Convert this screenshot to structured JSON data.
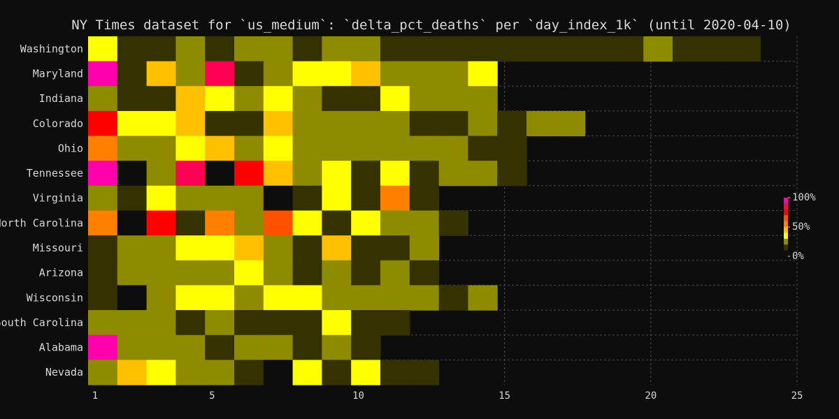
{
  "chart_data": {
    "type": "heatmap",
    "title": "NY Times dataset for `us_medium`: `delta_pct_deaths` per `day_index_1k` (until 2020-04-10)",
    "xlabel": "",
    "ylabel": "",
    "x_ticks": [
      "1",
      "5",
      "10",
      "15",
      "20",
      "25"
    ],
    "xlim": [
      1,
      25
    ],
    "grid": true,
    "legend": {
      "position": "right",
      "labels": [
        "100%",
        "50%",
        "0%"
      ]
    },
    "colors": {
      "background": "#0d0d0d",
      "l0": "#0d0d0d",
      "l1": "#343200",
      "l2": "#8f8b00",
      "l3": "#ffff00",
      "l4": "#ffc000",
      "l5": "#ff8000",
      "l6": "#ff5200",
      "l7": "#ff0000",
      "l8": "#ff0055",
      "l9": "#ff00aa"
    },
    "rows": [
      {
        "label": "Washington",
        "levels": [
          3,
          1,
          1,
          2,
          1,
          2,
          2,
          1,
          2,
          2,
          1,
          1,
          1,
          1,
          1,
          1,
          1,
          1,
          1,
          2,
          1,
          1,
          1
        ]
      },
      {
        "label": "Maryland",
        "levels": [
          9,
          1,
          4,
          2,
          8,
          1,
          2,
          3,
          3,
          4,
          2,
          2,
          2,
          3
        ]
      },
      {
        "label": "Indiana",
        "levels": [
          2,
          1,
          1,
          4,
          3,
          2,
          3,
          2,
          1,
          1,
          3,
          2,
          2,
          2
        ]
      },
      {
        "label": "Colorado",
        "levels": [
          7,
          3,
          3,
          4,
          1,
          1,
          4,
          2,
          2,
          2,
          2,
          1,
          1,
          2,
          1,
          2,
          2
        ]
      },
      {
        "label": "Ohio",
        "levels": [
          5,
          2,
          2,
          3,
          4,
          2,
          3,
          2,
          2,
          2,
          2,
          2,
          2,
          1,
          1
        ]
      },
      {
        "label": "Tennessee",
        "levels": [
          9,
          0,
          2,
          8,
          0,
          7,
          4,
          2,
          3,
          1,
          3,
          1,
          2,
          2,
          1
        ]
      },
      {
        "label": "Virginia",
        "levels": [
          2,
          1,
          3,
          2,
          2,
          2,
          0,
          1,
          3,
          1,
          5,
          1
        ]
      },
      {
        "label": "North Carolina",
        "levels": [
          5,
          0,
          7,
          1,
          5,
          2,
          6,
          3,
          1,
          3,
          2,
          2,
          1
        ]
      },
      {
        "label": "Missouri",
        "levels": [
          1,
          2,
          2,
          3,
          3,
          4,
          2,
          1,
          4,
          1,
          1,
          2
        ]
      },
      {
        "label": "Arizona",
        "levels": [
          1,
          2,
          2,
          2,
          2,
          3,
          2,
          1,
          2,
          1,
          2,
          1
        ]
      },
      {
        "label": "Wisconsin",
        "levels": [
          1,
          0,
          2,
          3,
          3,
          2,
          3,
          3,
          2,
          2,
          2,
          2,
          1,
          2
        ]
      },
      {
        "label": "South Carolina",
        "levels": [
          2,
          2,
          2,
          1,
          2,
          1,
          1,
          1,
          3,
          1,
          1
        ]
      },
      {
        "label": "Alabama",
        "levels": [
          9,
          2,
          2,
          2,
          1,
          2,
          2,
          1,
          2,
          1
        ]
      },
      {
        "label": "Nevada",
        "levels": [
          2,
          4,
          3,
          2,
          2,
          1,
          0,
          3,
          1,
          3,
          1,
          1
        ]
      }
    ]
  }
}
